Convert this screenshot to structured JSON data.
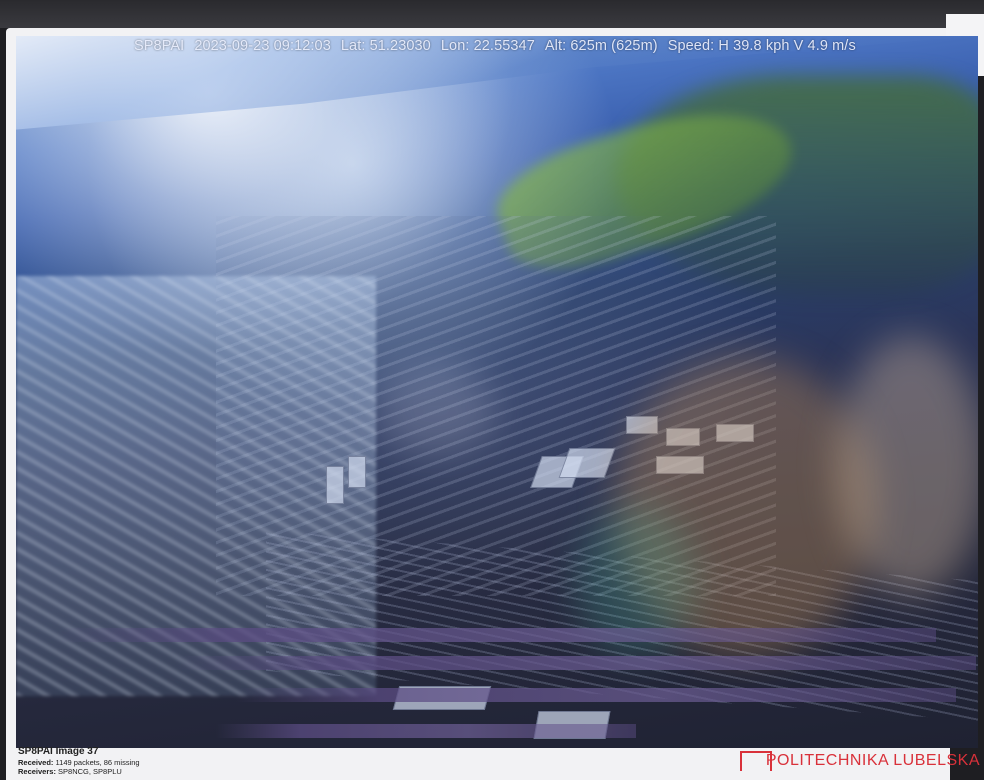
{
  "telemetry": {
    "callsign": "SP8PAI",
    "timestamp": "2023-09-23 09:12:03",
    "lat": "Lat: 51.23030",
    "lon": "Lon: 22.55347",
    "alt": "Alt: 625m (625m)",
    "speed": "Speed: H 39.8 kph  V 4.9 m/s"
  },
  "caption": {
    "title": "SP8PAI Image 37",
    "received_label": "Received:",
    "received_value": "1149 packets, 86 missing",
    "receivers_label": "Receivers:",
    "receivers_value": "SP8NCG, SP8PLU"
  },
  "logo": {
    "text": "POLITECHNIKA LUBELSKA"
  },
  "colors": {
    "brand": "#d9313a",
    "panel": "#f2f2f4"
  },
  "image_description_icon": "aerial-photo"
}
